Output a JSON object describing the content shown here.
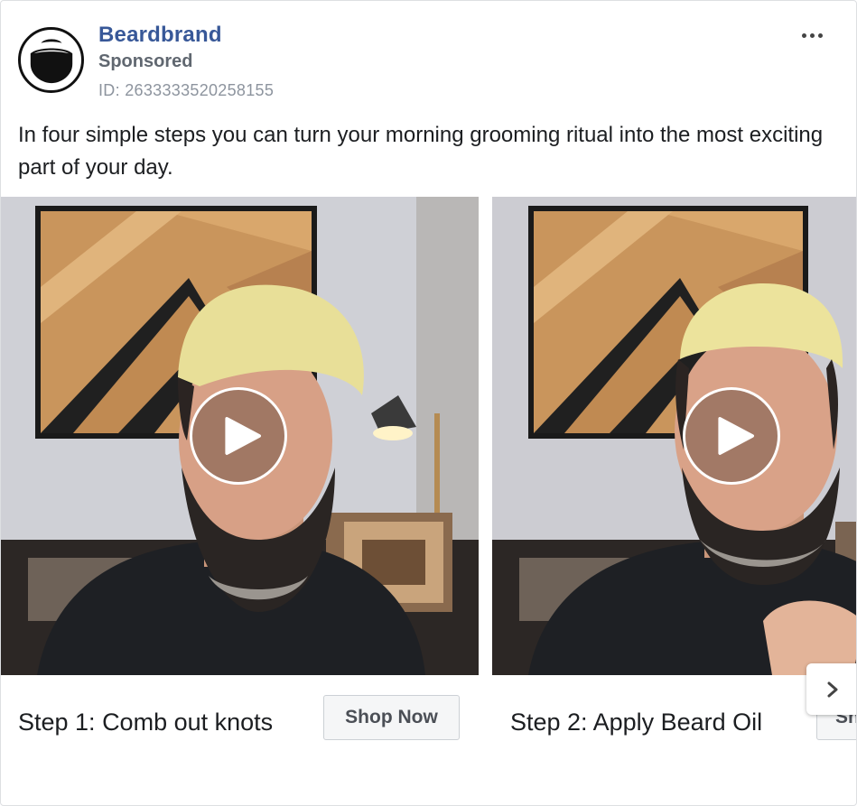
{
  "post": {
    "page_name": "Beardbrand",
    "sponsored_label": "Sponsored",
    "ad_id": "ID: 2633333520258155",
    "body_text": "In four simple steps you can turn your morning grooming ritual into the most exciting part of your day.",
    "more_icon": "more-horizontal-icon"
  },
  "carousel": {
    "slides": [
      {
        "caption": "Step 1: Comb out knots",
        "cta_label": "Shop Now",
        "media_icon": "play-icon"
      },
      {
        "caption": "Step 2: Apply Beard Oil",
        "cta_label": "Sh",
        "media_icon": "play-icon"
      }
    ],
    "next_icon": "chevron-right-icon"
  },
  "colors": {
    "page_name": "#385898",
    "secondary_text": "#606770",
    "muted_text": "#8d949e",
    "button_bg": "#f5f6f7"
  }
}
